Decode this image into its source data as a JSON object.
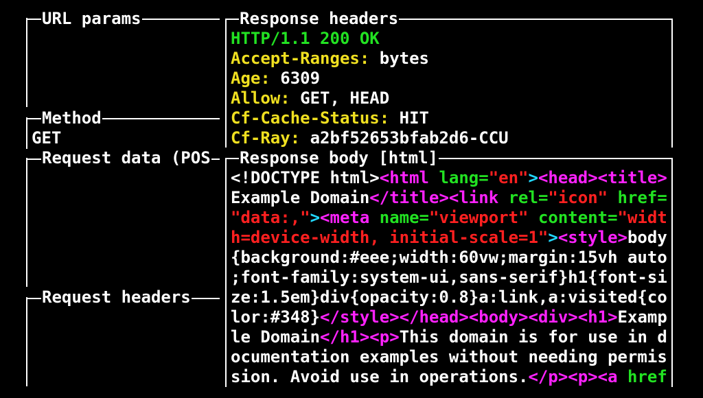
{
  "panels": {
    "url_params": "URL params",
    "method": "Method",
    "method_value": "GET",
    "request_data": "Request data (POS",
    "request_headers": "Request headers",
    "response_headers": "Response headers",
    "response_body": "Response body [html]"
  },
  "response_headers": {
    "status": "HTTP/1.1 200 OK",
    "rows": [
      {
        "key": "Accept-Ranges:",
        "value": " bytes"
      },
      {
        "key": "Age:",
        "value": " 6309"
      },
      {
        "key": "Allow:",
        "value": " GET, HEAD"
      },
      {
        "key": "Cf-Cache-Status:",
        "value": " HIT"
      },
      {
        "key": "Cf-Ray:",
        "value": " a2bf52653bfab2d6-CCU"
      }
    ]
  },
  "body_lines": [
    [
      {
        "t": "<!DOCTYPE html>",
        "c": "w"
      },
      {
        "t": "<html ",
        "c": "m"
      },
      {
        "t": "lang=",
        "c": "g"
      },
      {
        "t": "\"en\"",
        "c": "r"
      },
      {
        "t": ">",
        "c": "c"
      },
      {
        "t": "<head>",
        "c": "m"
      },
      {
        "t": "<title>",
        "c": "m"
      }
    ],
    [
      {
        "t": "Example Domain",
        "c": "w"
      },
      {
        "t": "</title>",
        "c": "m"
      },
      {
        "t": "<link ",
        "c": "m"
      },
      {
        "t": "rel=",
        "c": "g"
      },
      {
        "t": "\"icon\" ",
        "c": "r"
      },
      {
        "t": "href=",
        "c": "g"
      }
    ],
    [
      {
        "t": "\"data:,\"",
        "c": "r"
      },
      {
        "t": ">",
        "c": "c"
      },
      {
        "t": "<meta ",
        "c": "m"
      },
      {
        "t": "name=",
        "c": "g"
      },
      {
        "t": "\"viewport\" ",
        "c": "r"
      },
      {
        "t": "content=",
        "c": "g"
      },
      {
        "t": "\"widt",
        "c": "r"
      }
    ],
    [
      {
        "t": "h=device-width, initial-scale=1\"",
        "c": "r"
      },
      {
        "t": ">",
        "c": "c"
      },
      {
        "t": "<style>",
        "c": "m"
      },
      {
        "t": "body",
        "c": "w"
      }
    ],
    [
      {
        "t": "{background:#eee;width:60vw;margin:15vh auto",
        "c": "w"
      }
    ],
    [
      {
        "t": ";font-family:system-ui,sans-serif}h1{font-si",
        "c": "w"
      }
    ],
    [
      {
        "t": "ze:1.5em}div{opacity:0.8}a:link,a:visited{co",
        "c": "w"
      }
    ],
    [
      {
        "t": "lor:#348}",
        "c": "w"
      },
      {
        "t": "</style>",
        "c": "m"
      },
      {
        "t": "</head>",
        "c": "m"
      },
      {
        "t": "<body>",
        "c": "m"
      },
      {
        "t": "<div>",
        "c": "m"
      },
      {
        "t": "<h1>",
        "c": "m"
      },
      {
        "t": "Examp",
        "c": "w"
      }
    ],
    [
      {
        "t": "le Domain",
        "c": "w"
      },
      {
        "t": "</h1>",
        "c": "m"
      },
      {
        "t": "<p>",
        "c": "m"
      },
      {
        "t": "This domain is for use in d",
        "c": "w"
      }
    ],
    [
      {
        "t": "ocumentation examples without needing permis",
        "c": "w"
      }
    ],
    [
      {
        "t": "sion. Avoid use in operations.",
        "c": "w"
      },
      {
        "t": "</p>",
        "c": "m"
      },
      {
        "t": "<p>",
        "c": "m"
      },
      {
        "t": "<a ",
        "c": "m"
      },
      {
        "t": "href",
        "c": "g"
      }
    ]
  ]
}
